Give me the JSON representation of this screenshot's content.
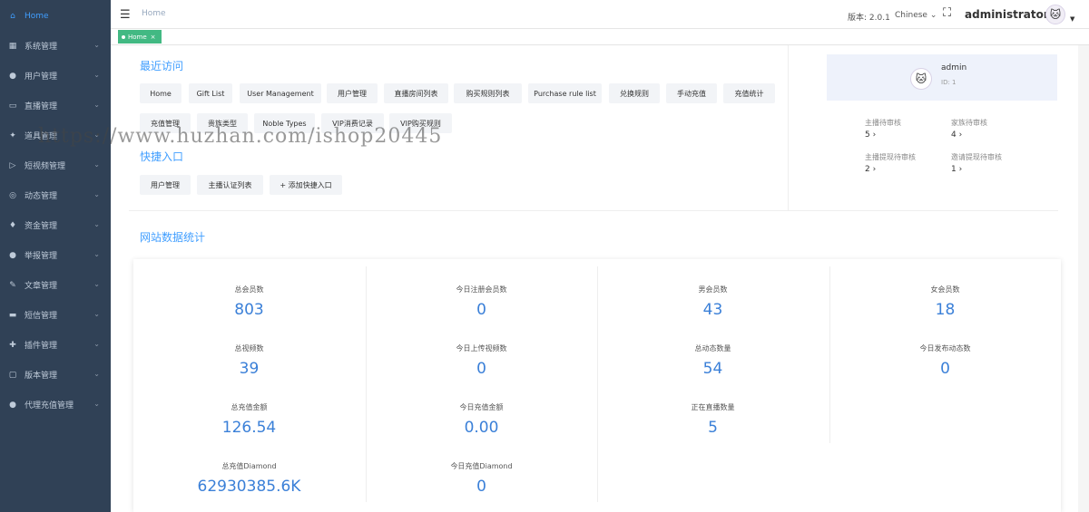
{
  "sidebar": {
    "items": [
      {
        "label": "Home",
        "icon": "home-icon"
      },
      {
        "label": "系统管理",
        "icon": "grid-icon"
      },
      {
        "label": "用户管理",
        "icon": "user-icon"
      },
      {
        "label": "直播管理",
        "icon": "video-icon"
      },
      {
        "label": "道具管理",
        "icon": "tool-icon"
      },
      {
        "label": "短视频管理",
        "icon": "film-icon"
      },
      {
        "label": "动态管理",
        "icon": "compass-icon"
      },
      {
        "label": "资金管理",
        "icon": "money-icon"
      },
      {
        "label": "举报管理",
        "icon": "report-icon"
      },
      {
        "label": "文章管理",
        "icon": "edit-icon"
      },
      {
        "label": "短信管理",
        "icon": "message-icon"
      },
      {
        "label": "插件管理",
        "icon": "plugin-icon"
      },
      {
        "label": "版本管理",
        "icon": "folder-icon"
      },
      {
        "label": "代理充值管理",
        "icon": "agent-icon"
      }
    ]
  },
  "header": {
    "breadcrumb": "Home",
    "version": "版本: 2.0.1",
    "language": "Chinese",
    "username": "administrator"
  },
  "tags": {
    "active": "Home"
  },
  "recent": {
    "title": "最近访问",
    "items": [
      "Home",
      "Gift List",
      "User Management",
      "用户管理",
      "直播房间列表",
      "购买规则列表",
      "Purchase rule list",
      "兑换规则",
      "手动充值",
      "充值统计",
      "充值管理",
      "贵族类型",
      "Noble Types",
      "VIP消费记录",
      "VIP购买规则"
    ]
  },
  "shortcuts": {
    "title": "快捷入口",
    "items": [
      "用户管理",
      "主播认证列表",
      "+ 添加快捷入口"
    ]
  },
  "admin": {
    "name": "admin",
    "id": "ID: 1"
  },
  "pending": [
    {
      "label": "主播待审核",
      "value": "5"
    },
    {
      "label": "家族待审核",
      "value": "4"
    },
    {
      "label": "主播提现待审核",
      "value": "2"
    },
    {
      "label": "邀请提现待审核",
      "value": "1"
    }
  ],
  "stats": {
    "title": "网站数据统计",
    "items": [
      {
        "label": "总会员数",
        "value": "803"
      },
      {
        "label": "今日注册会员数",
        "value": "0"
      },
      {
        "label": "男会员数",
        "value": "43"
      },
      {
        "label": "女会员数",
        "value": "18"
      },
      {
        "label": "总视频数",
        "value": "39"
      },
      {
        "label": "今日上传视频数",
        "value": "0"
      },
      {
        "label": "总动态数量",
        "value": "54"
      },
      {
        "label": "今日发布动态数",
        "value": "0"
      },
      {
        "label": "总充值金额",
        "value": "126.54"
      },
      {
        "label": "今日充值金额",
        "value": "0.00"
      },
      {
        "label": "正在直播数量",
        "value": "5"
      },
      {
        "label": "总充值Diamond",
        "value": "62930385.6K"
      },
      {
        "label": "今日充值Diamond",
        "value": "0"
      }
    ]
  },
  "watermark": "https://www.huzhan.com/ishop20445",
  "colors": {
    "sidebar": "#304156",
    "accent": "#409eff",
    "tag": "#42b983",
    "stat_value": "#3b80d8"
  }
}
